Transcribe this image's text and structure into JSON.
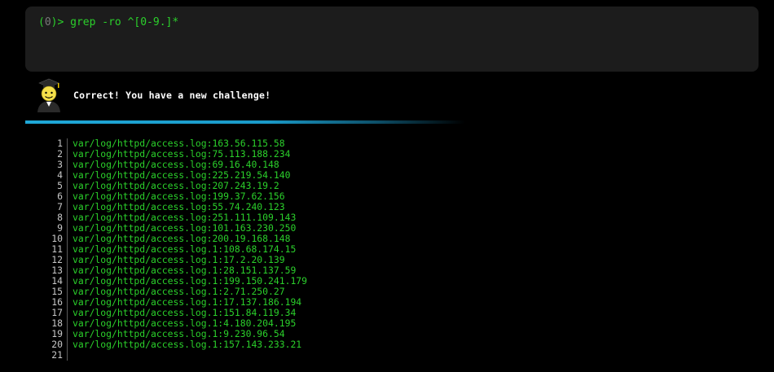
{
  "prompt": {
    "open_paren": "(",
    "zero": "0",
    "close": ")>",
    "command": "grep -ro ^[0-9.]*"
  },
  "feedback": {
    "avatar_icon": "graduate-avatar-icon",
    "message": "Correct! You have a new challenge!"
  },
  "progress": {
    "fraction": 0.57,
    "color": "#1fa8d8"
  },
  "output": {
    "lines": [
      {
        "num": "1",
        "text": "var/log/httpd/access.log:163.56.115.58"
      },
      {
        "num": "2",
        "text": "var/log/httpd/access.log:75.113.188.234"
      },
      {
        "num": "3",
        "text": "var/log/httpd/access.log:69.16.40.148"
      },
      {
        "num": "4",
        "text": "var/log/httpd/access.log:225.219.54.140"
      },
      {
        "num": "5",
        "text": "var/log/httpd/access.log:207.243.19.2"
      },
      {
        "num": "6",
        "text": "var/log/httpd/access.log:199.37.62.156"
      },
      {
        "num": "7",
        "text": "var/log/httpd/access.log:55.74.240.123"
      },
      {
        "num": "8",
        "text": "var/log/httpd/access.log:251.111.109.143"
      },
      {
        "num": "9",
        "text": "var/log/httpd/access.log:101.163.230.250"
      },
      {
        "num": "10",
        "text": "var/log/httpd/access.log:200.19.168.148"
      },
      {
        "num": "11",
        "text": "var/log/httpd/access.log.1:108.68.174.15"
      },
      {
        "num": "12",
        "text": "var/log/httpd/access.log.1:17.2.20.139"
      },
      {
        "num": "13",
        "text": "var/log/httpd/access.log.1:28.151.137.59"
      },
      {
        "num": "14",
        "text": "var/log/httpd/access.log.1:199.150.241.179"
      },
      {
        "num": "15",
        "text": "var/log/httpd/access.log.1:2.71.250.27"
      },
      {
        "num": "16",
        "text": "var/log/httpd/access.log.1:17.137.186.194"
      },
      {
        "num": "17",
        "text": "var/log/httpd/access.log.1:151.84.119.34"
      },
      {
        "num": "18",
        "text": "var/log/httpd/access.log.1:4.180.204.195"
      },
      {
        "num": "19",
        "text": "var/log/httpd/access.log.1:9.230.96.54"
      },
      {
        "num": "20",
        "text": "var/log/httpd/access.log.1:157.143.233.21"
      },
      {
        "num": "21",
        "text": ""
      }
    ]
  }
}
